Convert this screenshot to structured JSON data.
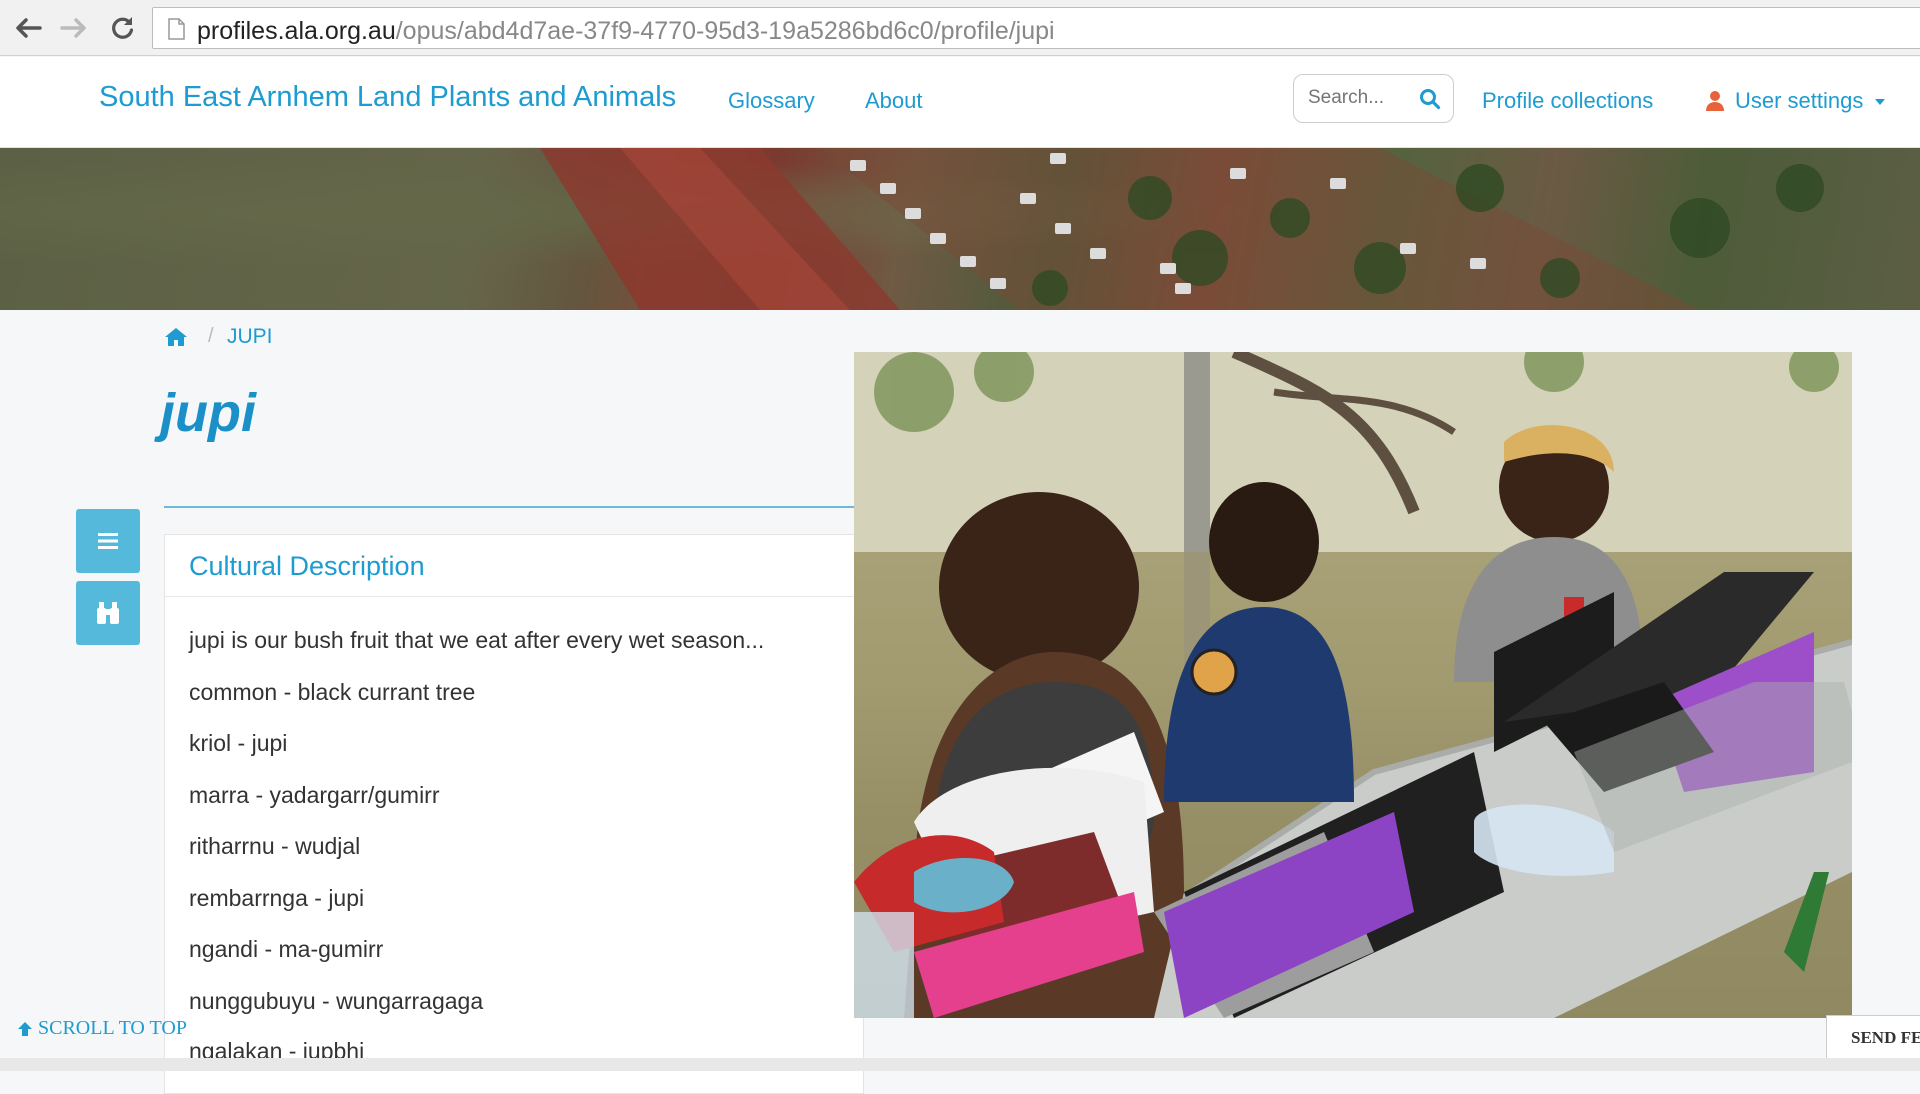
{
  "browser": {
    "url_host": "profiles.ala.org.au",
    "url_path": "/opus/abd4d7ae-37f9-4770-95d3-19a5286bd6c0/profile/jupi"
  },
  "header": {
    "brand": "South East Arnhem Land Plants and Animals",
    "nav": [
      "Glossary",
      "About"
    ],
    "search_placeholder": "Search...",
    "profile_collections": "Profile collections",
    "user_settings": "User settings"
  },
  "breadcrumb": {
    "current": "JUPI"
  },
  "profile": {
    "title": "jupi"
  },
  "cultural": {
    "heading": "Cultural Description",
    "lines": [
      "jupi is our bush fruit that we eat after every wet season...",
      "common - black currant tree",
      "kriol - jupi",
      "marra - yadargarr/gumirr",
      "ritharrnu - wudjal",
      "rembarrnga - jupi",
      "ngandi - ma-gumirr",
      "nunggubuyu - wungarragaga",
      "ngalakan - jupbhi"
    ]
  },
  "footer": {
    "scroll_to_top": "SCROLL TO TOP",
    "send_feedback": "SEND FE"
  },
  "colors": {
    "accent": "#1e9bd0",
    "side_button": "#55b9dc"
  }
}
